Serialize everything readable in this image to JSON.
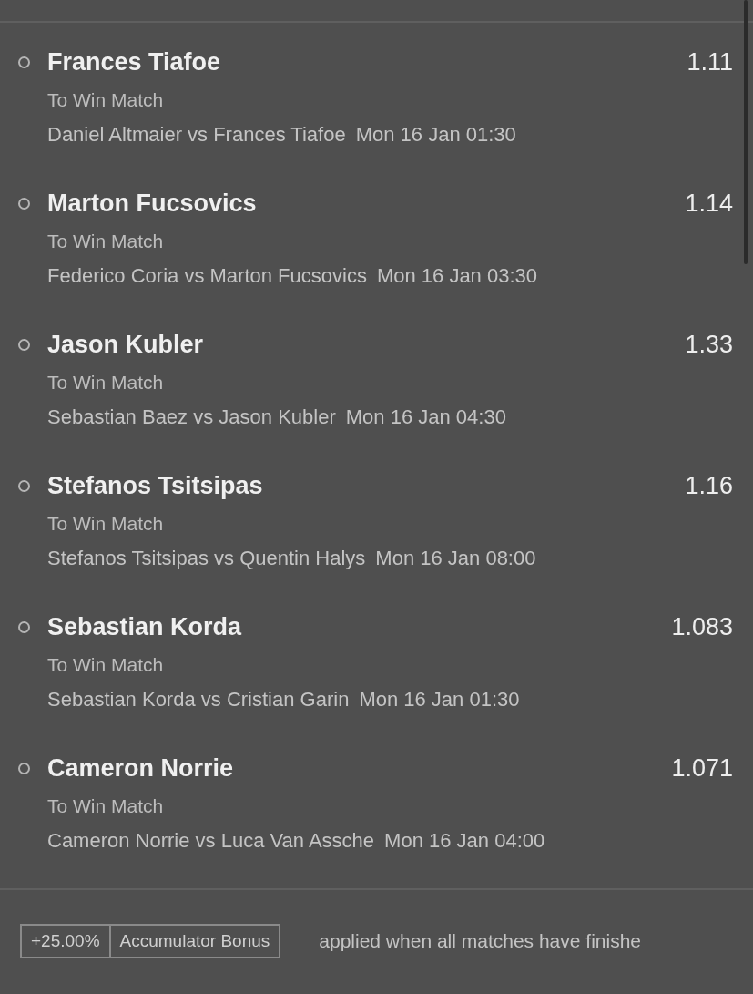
{
  "selections": [
    {
      "name": "Frances Tiafoe",
      "selected": false,
      "odds": "1.11",
      "market": "To Win Match",
      "match": "Daniel Altmaier vs Frances Tiafoe",
      "time": "Mon 16 Jan 01:30"
    },
    {
      "name": "Marton Fucsovics",
      "selected": false,
      "odds": "1.14",
      "market": "To Win Match",
      "match": "Federico Coria vs Marton Fucsovics",
      "time": "Mon 16 Jan 03:30"
    },
    {
      "name": "Jason Kubler",
      "selected": false,
      "odds": "1.33",
      "market": "To Win Match",
      "match": "Sebastian Baez vs Jason Kubler",
      "time": "Mon 16 Jan 04:30"
    },
    {
      "name": "Stefanos Tsitsipas",
      "selected": false,
      "odds": "1.16",
      "market": "To Win Match",
      "match": "Stefanos Tsitsipas vs Quentin Halys",
      "time": "Mon 16 Jan 08:00"
    },
    {
      "name": "Sebastian Korda",
      "selected": false,
      "odds": "1.083",
      "market": "To Win Match",
      "match": "Sebastian Korda vs Cristian Garin",
      "time": "Mon 16 Jan 01:30"
    },
    {
      "name": "Cameron Norrie",
      "selected": false,
      "odds": "1.071",
      "market": "To Win Match",
      "match": "Cameron Norrie vs Luca Van Assche",
      "time": "Mon 16 Jan 04:00"
    }
  ],
  "bonus": {
    "percent": "+25.00%",
    "label": "Accumulator Bonus",
    "note": "applied when all matches have finishe"
  }
}
